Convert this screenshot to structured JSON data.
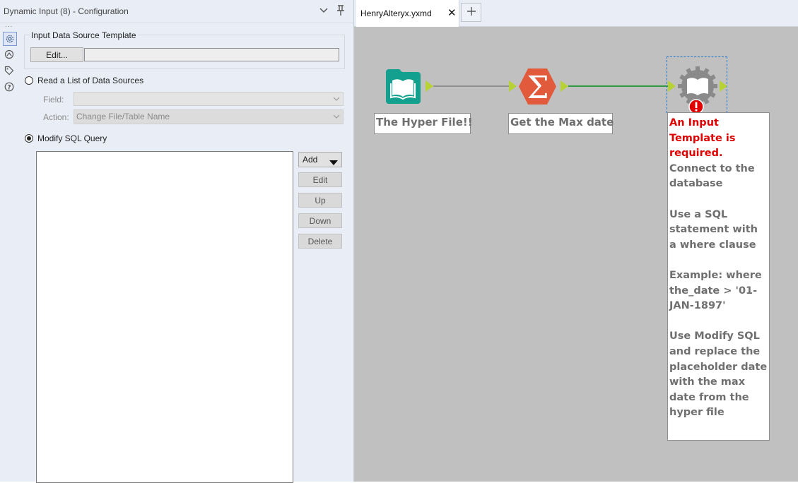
{
  "panel": {
    "title": "Dynamic Input (8) - Configuration",
    "rail_dots": "...",
    "template_group_label": "Input Data Source Template",
    "edit_button": "Edit...",
    "template_path_value": "",
    "read_list_label": "Read a List of Data Sources",
    "field_label": "Field:",
    "field_value": "",
    "action_label": "Action:",
    "action_value": "Change File/Table Name",
    "modify_sql_label": "Modify SQL Query",
    "selected_mode": "Modify SQL Query",
    "sql_actions": {
      "add": "Add",
      "edit": "Edit",
      "up": "Up",
      "down": "Down",
      "delete": "Delete"
    }
  },
  "tabs": {
    "active_tab": "HenryAlteryx.yxmd",
    "close_glyph": "✕",
    "new_tab_glyph": "+"
  },
  "workflow": {
    "tools": [
      {
        "name": "input-data-tool",
        "label": "The Hyper File!!",
        "color": "#13a08e"
      },
      {
        "name": "summarize-tool",
        "label": "Get the Max date",
        "color": "#e15a3c"
      },
      {
        "name": "dynamic-input-tool",
        "label": "",
        "color": "#8a8a8a",
        "status": "error"
      }
    ],
    "annotation": {
      "error": "An Input Template is required.",
      "body": "Connect to the database\n\nUse a SQL statement with a where clause\n\nExample:  where the_date > '01-JAN-1897'\n\nUse Modify SQL and replace the placeholder date with the max date from the hyper file"
    },
    "connection_colors": {
      "first": "#777777",
      "second": "#2e9a3e"
    },
    "anchor_color": "#b7d234"
  }
}
